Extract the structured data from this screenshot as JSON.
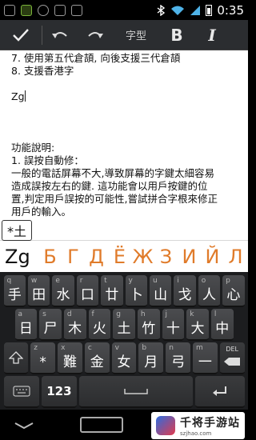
{
  "status": {
    "time": "0:35"
  },
  "toolbar": {
    "font_label": "字型",
    "bold_label": "B",
    "italic_label": "I"
  },
  "document": {
    "lines": [
      "7. 使用第五代倉頡, 向後支援三代倉頡",
      "8. 支援香港字",
      "",
      "Zg",
      "",
      "",
      "",
      "功能說明:",
      "1. 誤按自動修：",
      "一般的電話屏幕不大,導致屏幕的字鍵太細容易",
      "造成誤按左右的鍵. 這功能會以用戶按鍵的位",
      "置,判定用戶誤按的可能性,嘗試拼合字根來修正",
      "用戶的輸入。"
    ]
  },
  "candidates": {
    "popup_key": "*土",
    "typed": "Zg",
    "list": [
      "Б",
      "Г",
      "Д",
      "Ё",
      "Ж",
      "З",
      "И",
      "Й",
      "Л"
    ]
  },
  "keyboard": {
    "row1": [
      {
        "hint": "q",
        "label": "手"
      },
      {
        "hint": "w",
        "label": "田"
      },
      {
        "hint": "e",
        "label": "水"
      },
      {
        "hint": "r",
        "label": "口"
      },
      {
        "hint": "t",
        "label": "廿"
      },
      {
        "hint": "y",
        "label": "卜"
      },
      {
        "hint": "u",
        "label": "山"
      },
      {
        "hint": "i",
        "label": "戈"
      },
      {
        "hint": "o",
        "label": "人"
      },
      {
        "hint": "p",
        "label": "心"
      }
    ],
    "row2": [
      {
        "hint": "a",
        "label": "日"
      },
      {
        "hint": "s",
        "label": "尸"
      },
      {
        "hint": "d",
        "label": "木"
      },
      {
        "hint": "f",
        "label": "火"
      },
      {
        "hint": "g",
        "label": "土"
      },
      {
        "hint": "h",
        "label": "竹"
      },
      {
        "hint": "j",
        "label": "十"
      },
      {
        "hint": "k",
        "label": "大"
      },
      {
        "hint": "l",
        "label": "中"
      }
    ],
    "row3": [
      {
        "hint": "z",
        "label": "*"
      },
      {
        "hint": "x",
        "label": "難"
      },
      {
        "hint": "c",
        "label": "金"
      },
      {
        "hint": "v",
        "label": "女"
      },
      {
        "hint": "b",
        "label": "月"
      },
      {
        "hint": "n",
        "label": "弓"
      },
      {
        "hint": "m",
        "label": "一"
      }
    ],
    "delete_label": "DEL",
    "numeric_label": "123"
  },
  "watermark": {
    "title": "千将手游站",
    "subtitle": "szjhao.com"
  }
}
